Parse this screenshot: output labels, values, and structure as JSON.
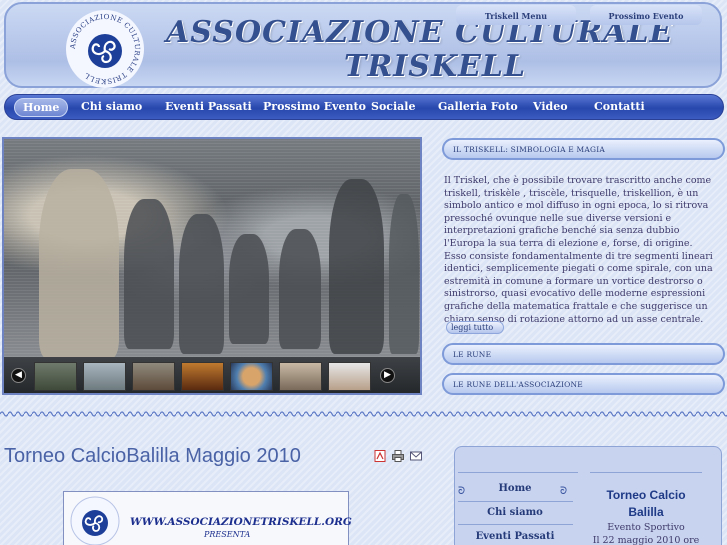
{
  "header": {
    "title_line1": "ASSOCIAZIONE  CULTURALE",
    "title_line2": "TRISKELL",
    "logo_text": "ASSOCIAZIONE CULTURALE TRISKELL"
  },
  "nav": {
    "items": [
      {
        "label": "Home",
        "active": true
      },
      {
        "label": "Chi siamo"
      },
      {
        "label": "Eventi Passati"
      },
      {
        "label": "Prossimo Evento"
      },
      {
        "label": "Sociale"
      },
      {
        "label": "Galleria Foto"
      },
      {
        "label": "Video"
      },
      {
        "label": "Contatti"
      }
    ]
  },
  "slider": {
    "prev_icon": "chevron-left-icon",
    "next_icon": "chevron-right-icon",
    "thumbnail_count": 7
  },
  "news": {
    "tab1": "IL TRISKELL: SIMBOLOGIA E MAGIA",
    "body": "Il Triskel, che è possibile trovare trascritto anche come triskell, triskèle , triscèle, trisquelle, triskellion, è un simbolo antico e mol diffuso in ogni epoca, lo si ritrova pressoché ovunque nelle sue diverse versioni e interpretazioni grafiche benché sia senza dubbio l'Europa  la sua terra di elezione e, forse, di origine. Esso consiste fondamentalmente di tre segmenti lineari identici, semplicemente piegati o come spirale, con una estremità in comune a formare un vortice destrorso o sinistrorso, quasi evocativo delle moderne espressioni grafiche della matematica frattale e che suggerisce un chiaro senso di rotazione attorno ad un asse centrale.",
    "read_more": "leggi tutto",
    "tab2": "LE RUNE",
    "tab3": "LE RUNE DELL'ASSOCIAZIONE"
  },
  "article": {
    "title": "Torneo CalcioBalilla Maggio 2010",
    "icons": [
      "pdf-icon",
      "print-icon",
      "email-icon"
    ],
    "promo_url": "WWW.ASSOCIAZIONETRISKELL.ORG",
    "promo_sub": "PRESENTA"
  },
  "sidebar": {
    "menu_title": "Triskell Menu",
    "menu_items": [
      "Home",
      "Chi siamo",
      "Eventi Passati"
    ],
    "event_title": "Prossimo Evento",
    "event_name": "Torneo Calcio Balilla",
    "event_type": "Evento Sportivo",
    "event_date": "Il 22 maggio 2010 ore"
  },
  "colors": {
    "accent": "#2747ad",
    "header_bg": "#aebfe6",
    "title_text": "#35508f",
    "body_text": "#3f3a6b"
  }
}
